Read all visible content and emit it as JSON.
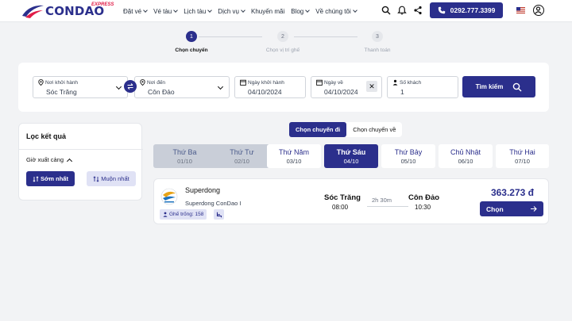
{
  "header": {
    "logo_express": "EXPRESS",
    "logo_main": "CONDAO",
    "nav": [
      {
        "label": "Đặt vé",
        "dropdown": true
      },
      {
        "label": "Vé tàu",
        "dropdown": true
      },
      {
        "label": "Lịch tàu",
        "dropdown": true
      },
      {
        "label": "Dịch vụ",
        "dropdown": true
      },
      {
        "label": "Khuyến mãi",
        "dropdown": false
      },
      {
        "label": "Blog",
        "dropdown": true
      },
      {
        "label": "Về chúng tôi",
        "dropdown": true
      }
    ],
    "phone": "0292.777.3399",
    "accent_color": "#2b2f8c"
  },
  "stepper": {
    "steps": [
      {
        "number": "1",
        "label": "Chọn chuyến",
        "active": true
      },
      {
        "number": "2",
        "label": "Chọn vị trí ghế",
        "active": false
      },
      {
        "number": "3",
        "label": "Thanh toán",
        "active": false
      }
    ]
  },
  "search": {
    "from_label": "Nơi khởi hành",
    "from_value": "Sóc Trăng",
    "to_label": "Nơi đến",
    "to_value": "Côn Đảo",
    "depart_label": "Ngày khởi hành",
    "depart_value": "04/10/2024",
    "return_label": "Ngày về",
    "return_value": "04/10/2024",
    "passengers_label": "Số khách",
    "passengers_value": "1",
    "search_label": "Tìm kiếm"
  },
  "filter": {
    "title": "Lọc kết quả",
    "group_label": "Giờ xuất cảng",
    "earliest_label": "Sớm nhất",
    "latest_label": "Muộn nhất"
  },
  "direction_tabs": {
    "outbound": "Chọn chuyến đi",
    "return": "Chọn chuyến về"
  },
  "dates": [
    {
      "day": "Thứ Ba",
      "date": "01/10",
      "state": "past"
    },
    {
      "day": "Thứ Tư",
      "date": "02/10",
      "state": "past"
    },
    {
      "day": "Thứ Năm",
      "date": "03/10",
      "state": "future"
    },
    {
      "day": "Thứ Sáu",
      "date": "04/10",
      "state": "active"
    },
    {
      "day": "Thứ Bảy",
      "date": "05/10",
      "state": "future"
    },
    {
      "day": "Chủ Nhật",
      "date": "06/10",
      "state": "future"
    },
    {
      "day": "Thứ Hai",
      "date": "07/10",
      "state": "future"
    }
  ],
  "trip": {
    "company": "Superdong",
    "vessel": "Superdong ConDao I",
    "seats_label": "Ghế trống: 158",
    "from": "Sóc Trăng",
    "depart_time": "08:00",
    "duration": "2h 30m",
    "to": "Côn Đảo",
    "arrive_time": "10:30",
    "price": "363.273 đ",
    "choose_label": "Chọn"
  }
}
